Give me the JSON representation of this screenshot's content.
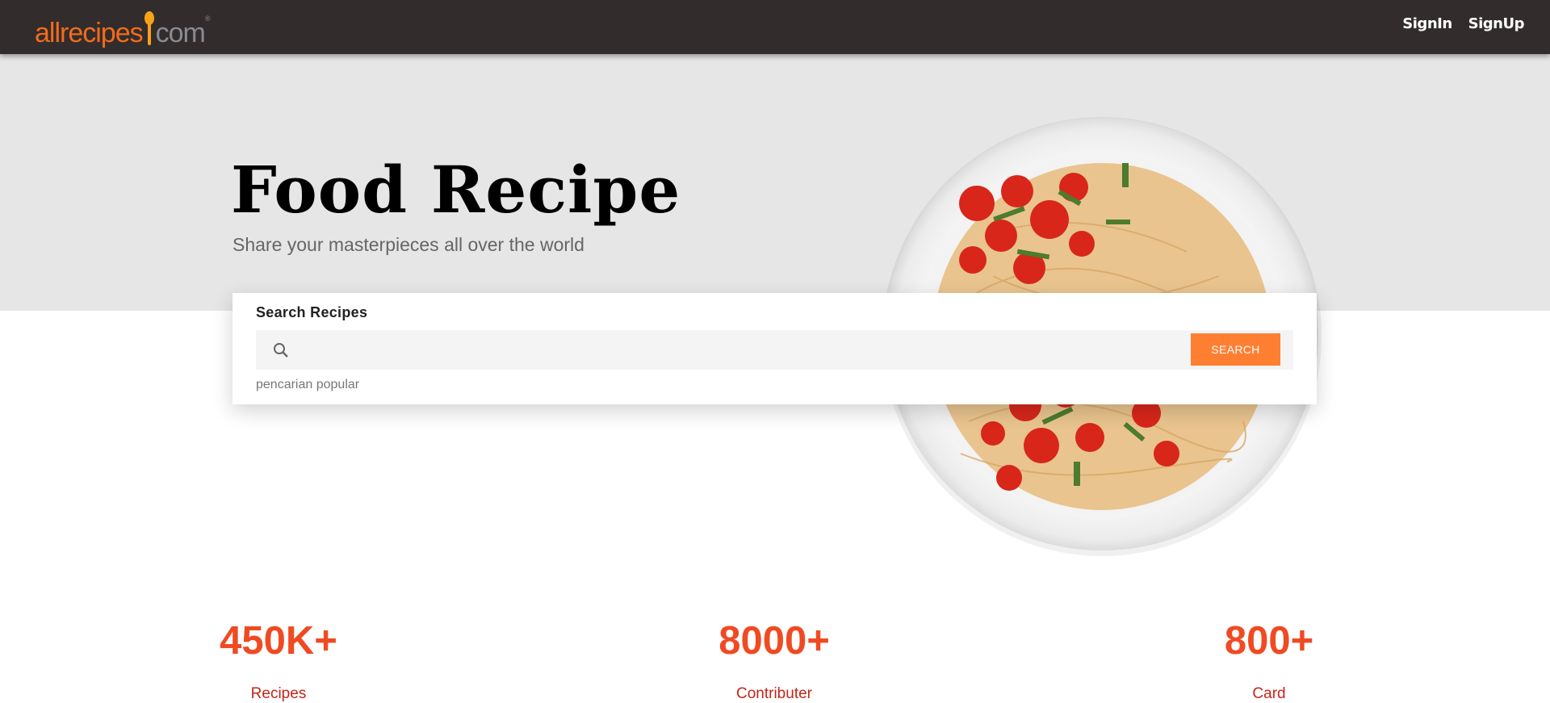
{
  "nav": {
    "logo": {
      "text_main": "allrecipes",
      "text_suffix": "com",
      "mark": "®"
    },
    "links": [
      {
        "label": "SignIn"
      },
      {
        "label": "SignUp"
      }
    ]
  },
  "hero": {
    "title": "Food Recipe",
    "subtitle": "Share your masterpieces all over the world",
    "image": "pasta-plate"
  },
  "search": {
    "label": "Search Recipes",
    "value": "",
    "placeholder": "",
    "button_label": "SEARCH",
    "popular_label": "pencarian popular",
    "icon": "search-icon"
  },
  "stats": [
    {
      "value": "450K+",
      "label": "Recipes"
    },
    {
      "value": "8000+",
      "label": "Contributer"
    },
    {
      "value": "800+",
      "label": "Card"
    }
  ],
  "colors": {
    "nav_bg": "#322d2c",
    "accent": "#ff7f32",
    "stat": "#f04a23",
    "logo": "#f26b1d"
  }
}
